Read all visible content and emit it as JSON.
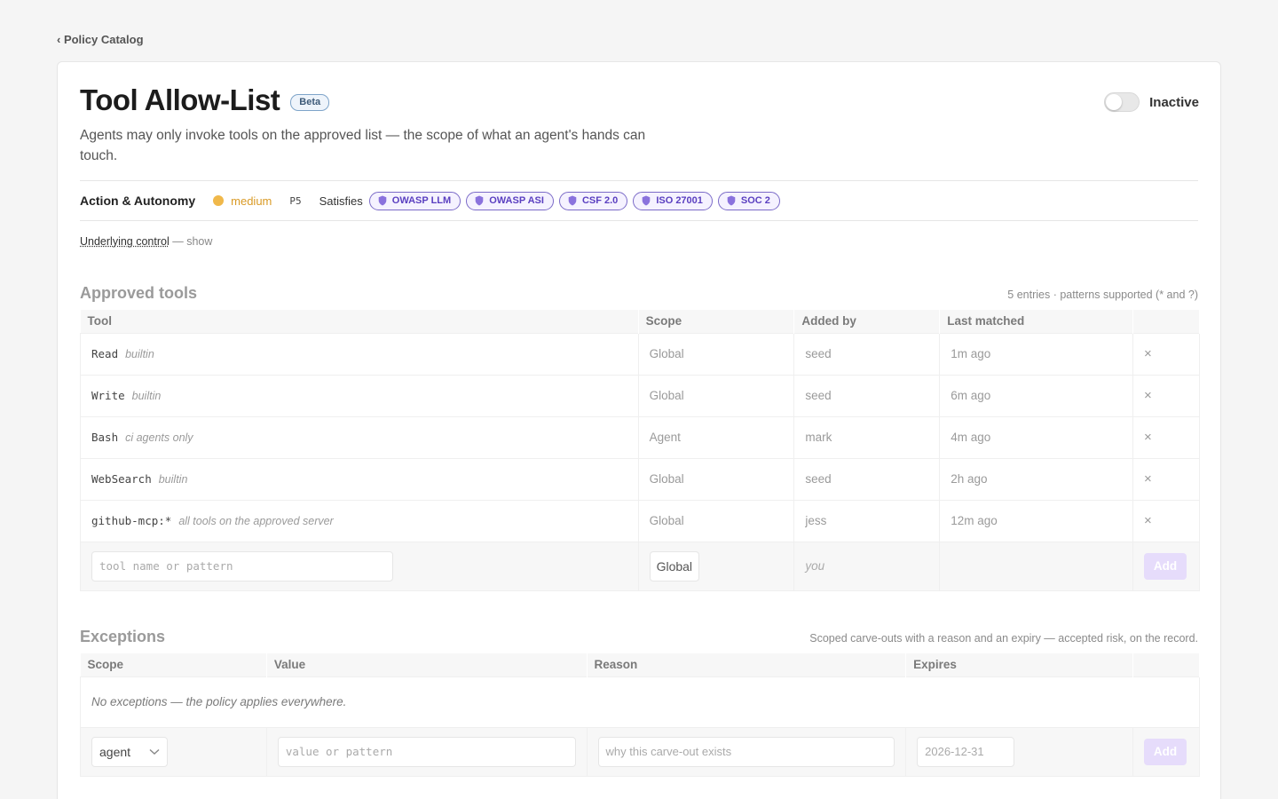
{
  "nav": {
    "back_label": "‹ Policy Catalog"
  },
  "header": {
    "title": "Tool Allow-List",
    "badge": "Beta",
    "status_label": "Inactive",
    "description": "Agents may only invoke tools on the approved list — the scope of what an agent's hands can touch."
  },
  "meta": {
    "category": "Action & Autonomy",
    "severity": "medium",
    "priority": "P5",
    "satisfies_label": "Satisfies",
    "frameworks": [
      "OWASP LLM",
      "OWASP ASI",
      "CSF 2.0",
      "ISO 27001",
      "SOC 2"
    ]
  },
  "underlying": {
    "link": "Underlying control",
    "rest": "— show"
  },
  "approved": {
    "title": "Approved tools",
    "note": "5 entries · patterns supported (* and ?)",
    "columns": [
      "Tool",
      "Scope",
      "Added by",
      "Last matched",
      ""
    ],
    "rows": [
      {
        "tool": "Read",
        "note": "builtin",
        "scope": "Global",
        "added_by": "seed",
        "last_matched": "1m ago"
      },
      {
        "tool": "Write",
        "note": "builtin",
        "scope": "Global",
        "added_by": "seed",
        "last_matched": "6m ago"
      },
      {
        "tool": "Bash",
        "note": "ci agents only",
        "scope": "Agent",
        "added_by": "mark",
        "last_matched": "4m ago"
      },
      {
        "tool": "WebSearch",
        "note": "builtin",
        "scope": "Global",
        "added_by": "seed",
        "last_matched": "2h ago"
      },
      {
        "tool": "github-mcp:*",
        "note": "all tools on the approved server",
        "scope": "Global",
        "added_by": "jess",
        "last_matched": "12m ago"
      }
    ],
    "remove_glyph": "×",
    "add_row": {
      "placeholder": "tool name or pattern",
      "scope": "Global",
      "added_by": "you",
      "button": "Add"
    }
  },
  "exceptions": {
    "title": "Exceptions",
    "note": "Scoped carve-outs with a reason and an expiry — accepted risk, on the record.",
    "columns": [
      "Scope",
      "Value",
      "Reason",
      "Expires",
      ""
    ],
    "empty": "No exceptions — the policy applies everywhere.",
    "add_row": {
      "scope": "agent",
      "value_placeholder": "value or pattern",
      "reason_placeholder": "why this carve-out exists",
      "expires": "2026-12-31",
      "button": "Add"
    }
  },
  "colors": {
    "accent": "#5a3fc0",
    "severity": "#f0b84a",
    "add_button": "#e6dcfb"
  }
}
